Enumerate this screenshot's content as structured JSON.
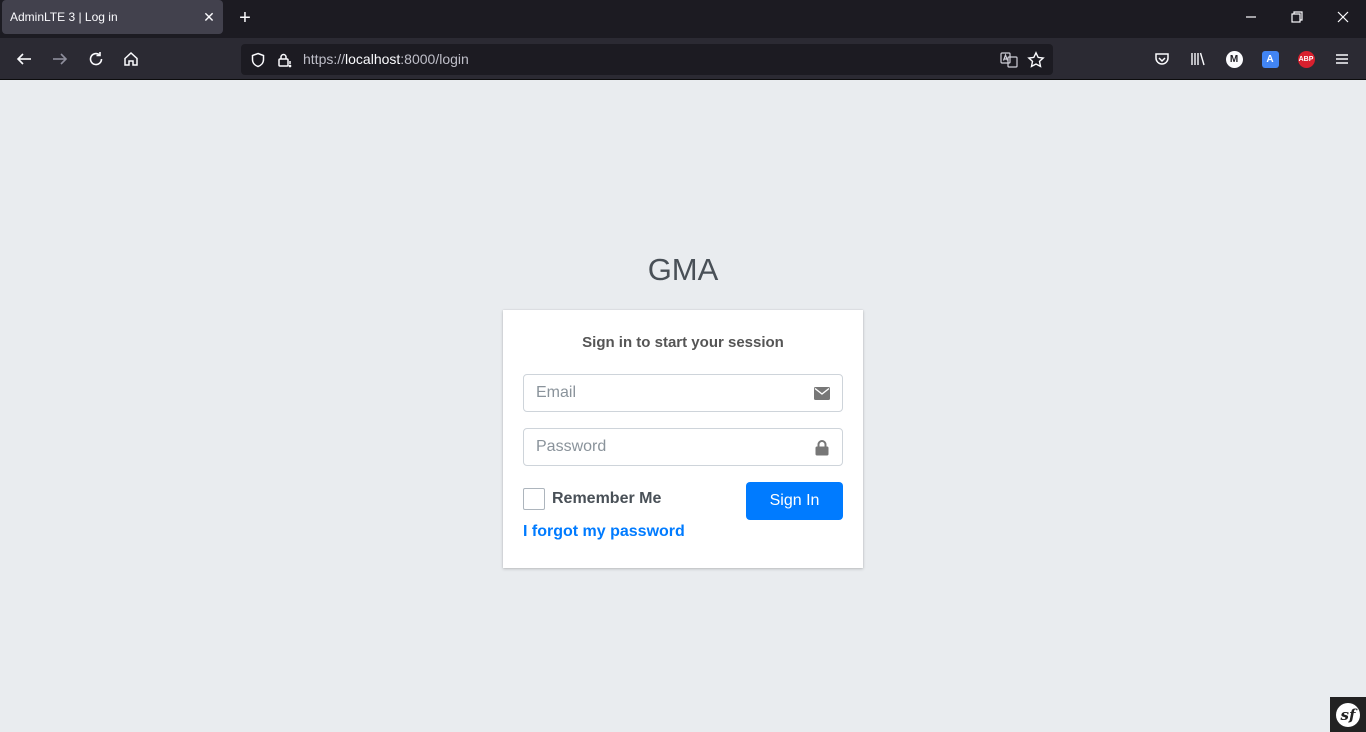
{
  "browser": {
    "tab_title": "AdminLTE 3 | Log in",
    "tab_close": "✕",
    "new_tab": "+",
    "url_prefix": "https://",
    "url_host": "localhost",
    "url_rest": ":8000/login",
    "extensions": {
      "m_label": "M",
      "abp_label": "ABP",
      "translate_label": "A"
    }
  },
  "page": {
    "logo": "GMA",
    "login_message": "Sign in to start your session",
    "email": {
      "placeholder": "Email",
      "value": ""
    },
    "password": {
      "placeholder": "Password",
      "value": ""
    },
    "remember_label": "Remember Me",
    "remember_checked": false,
    "signin_label": "Sign In",
    "forgot_label": "I forgot my password",
    "accent_color": "#007bff",
    "background_color": "#e9ecef"
  },
  "debug_toolbar": {
    "logo_glyph": "sf"
  }
}
